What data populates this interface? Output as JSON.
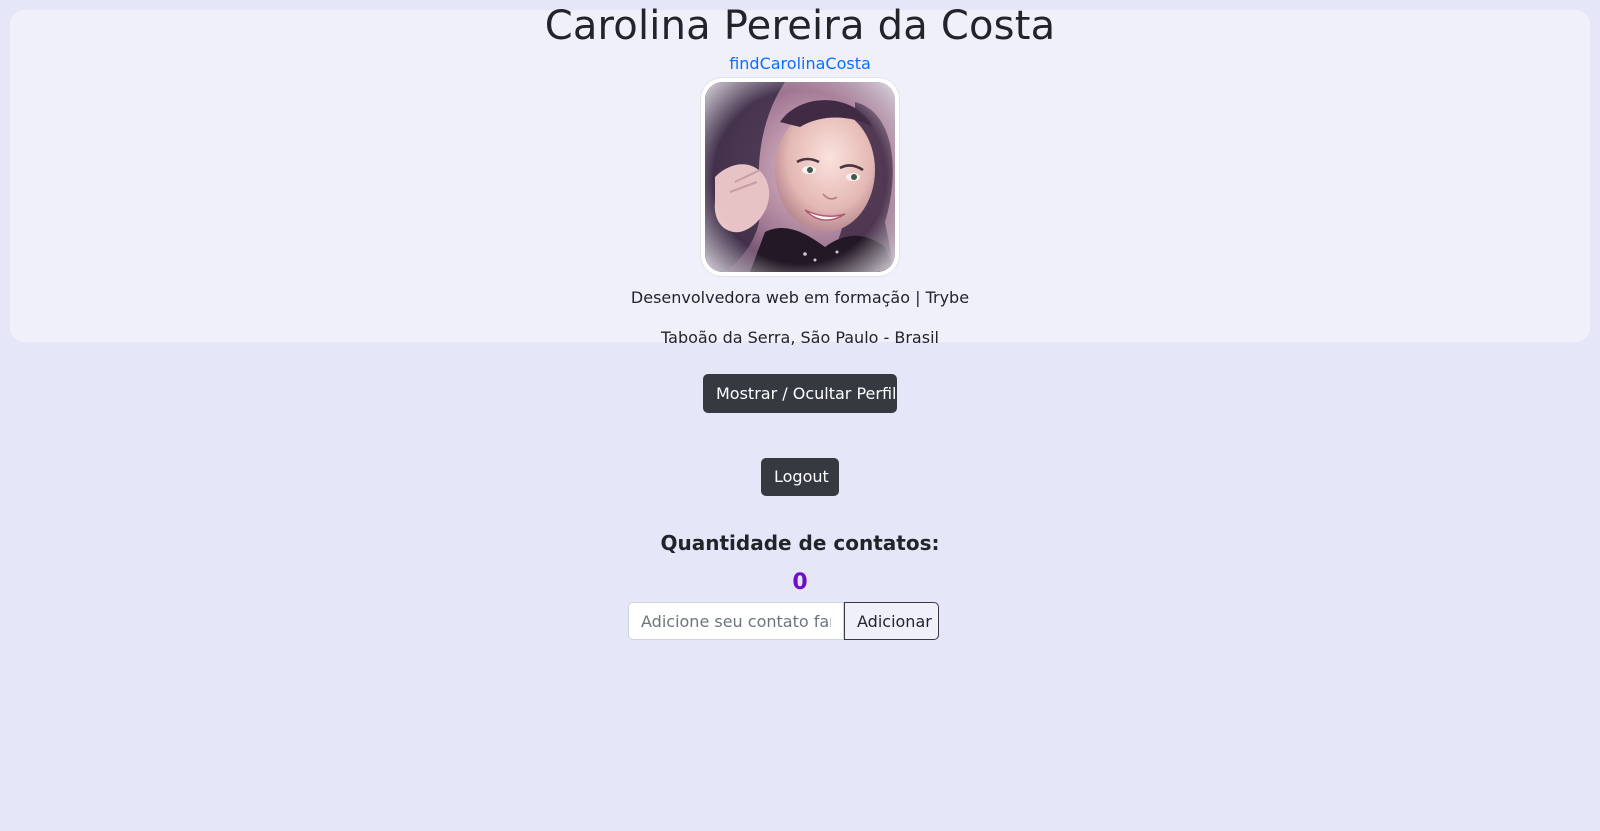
{
  "profile": {
    "name": "Carolina Pereira da Costa",
    "username_link": "findCarolinaCosta",
    "avatar_alt": "Carolina Pereira da Costa",
    "bio": "Desenvolvedora web em formação | Trybe",
    "location": "Taboão da Serra, São Paulo - Brasil"
  },
  "actions": {
    "toggle_profile_label": "Mostrar / Ocultar Perfil",
    "logout_label": "Logout"
  },
  "contacts": {
    "title": "Quantidade de contatos:",
    "count": "0",
    "input_placeholder": "Adicione seu contato famoso",
    "input_value": "",
    "add_label": "Adicionar"
  },
  "colors": {
    "page_background": "#e6e6f9",
    "card_background": "#f0f0fa",
    "link": "#0d6efd",
    "count": "#6f0dc8",
    "button_dark": "#343a40"
  }
}
